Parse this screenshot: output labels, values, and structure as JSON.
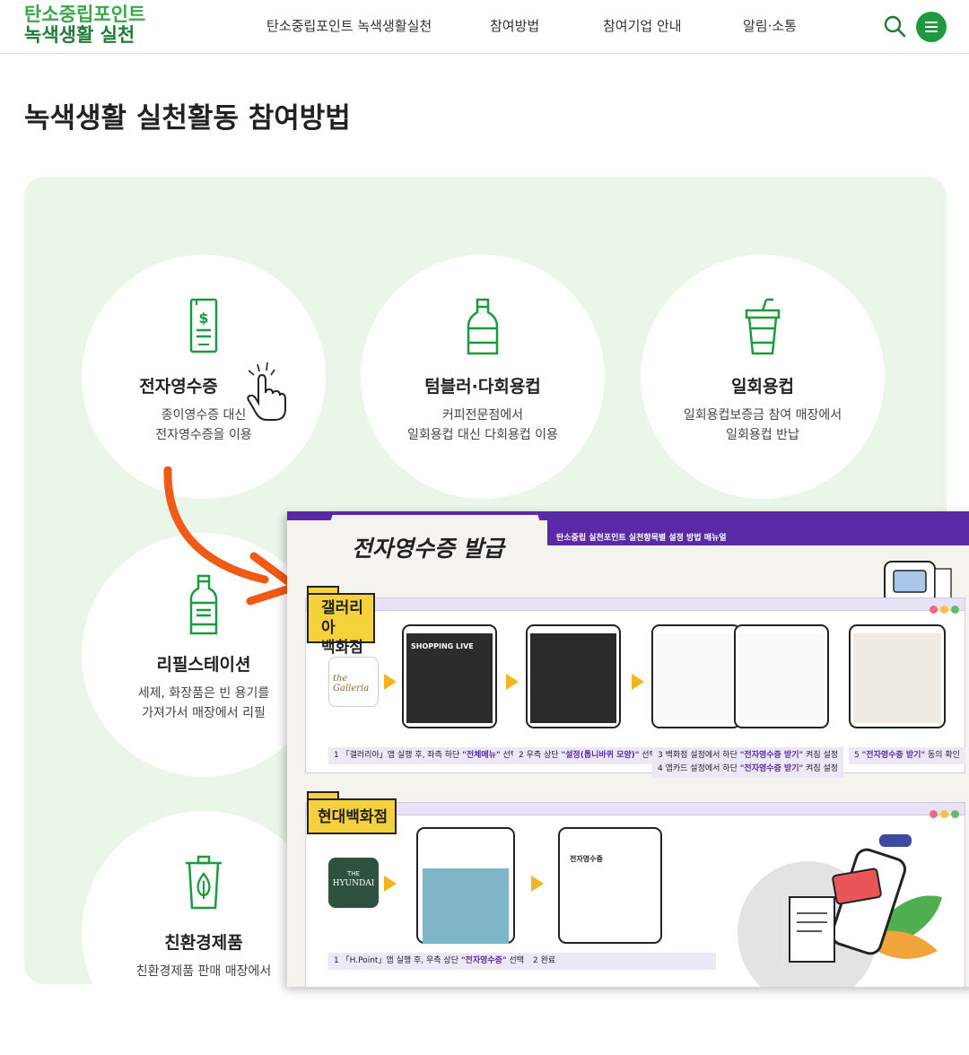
{
  "header": {
    "logo_line1": "탄소중립포인트",
    "logo_line2": "녹색생활 실천",
    "nav": [
      "탄소중립포인트 녹색생활실천",
      "참여방법",
      "참여기업 안내",
      "알림·소통"
    ]
  },
  "page": {
    "title": "녹색생활 실천활동 참여방법"
  },
  "cards": [
    {
      "title": "전자영수증",
      "desc1": "종이영수증 대신",
      "desc2": "전자영수증을 이용"
    },
    {
      "title": "텀블러·다회용컵",
      "desc1": "커피전문점에서",
      "desc2": "일회용컵 대신 다회용컵 이용"
    },
    {
      "title": "일회용컵",
      "desc1": "일회용컵보증금 참여 매장에서",
      "desc2": "일회용컵 반납"
    },
    {
      "title": "리필스테이션",
      "desc1": "세제, 화장품은 빈 용기를",
      "desc2": "가져가서 매장에서 리필"
    },
    {
      "title": "친환경제품",
      "desc1": "친환경제품 판매 매장에서",
      "desc2": ""
    }
  ],
  "manual": {
    "title": "전자영수증 발급",
    "subtitle": "탄소중립 실천포인트 실천항목별 설정 방법 매뉴얼",
    "galleria": {
      "tag_line1": "갤러리아",
      "tag_line2": "백화점",
      "app_label": "the Galleria",
      "phone1_label": "SHOPPING LIVE",
      "steps": [
        {
          "num": "1",
          "pre": "「갤러리아」앱 실행 후, 좌측 하단 ",
          "bold": "\"전체메뉴\"",
          "post": " 선택"
        },
        {
          "num": "2",
          "pre": "우측 상단 ",
          "bold": "\"설정(톱니바퀴 모양)\"",
          "post": " 선택"
        },
        {
          "num": "3",
          "pre": "백화점 설정에서 하단 ",
          "bold": "\"전자영수증 받기\"",
          "post": " 켜짐 설정"
        },
        {
          "num": "4",
          "pre": "앱카드 설정에서 하단 ",
          "bold": "\"전자영수증 받기\"",
          "post": " 켜짐 설정"
        },
        {
          "num": "5",
          "pre": "",
          "bold": "\"전자영수증 받기\"",
          "post": " 동의 확인"
        }
      ]
    },
    "hyundai": {
      "tag": "현대백화점",
      "app_label_top": "THE",
      "app_label": "HYUNDAI",
      "phone2_title": "전자영수증",
      "steps": [
        {
          "num": "1",
          "pre": "「H.Point」앱 실행 후, 우측 상단 ",
          "bold": "\"전자영수증\"",
          "post": " 선택"
        },
        {
          "num": "2",
          "pre": "완료",
          "bold": "",
          "post": ""
        }
      ]
    }
  },
  "colors": {
    "brand_green": "#1e9a3e",
    "panel_bg": "#eaf6e7",
    "arrow": "#f05a14",
    "manual_purple": "#5a2aa6",
    "tag_yellow": "#f5d23c"
  }
}
